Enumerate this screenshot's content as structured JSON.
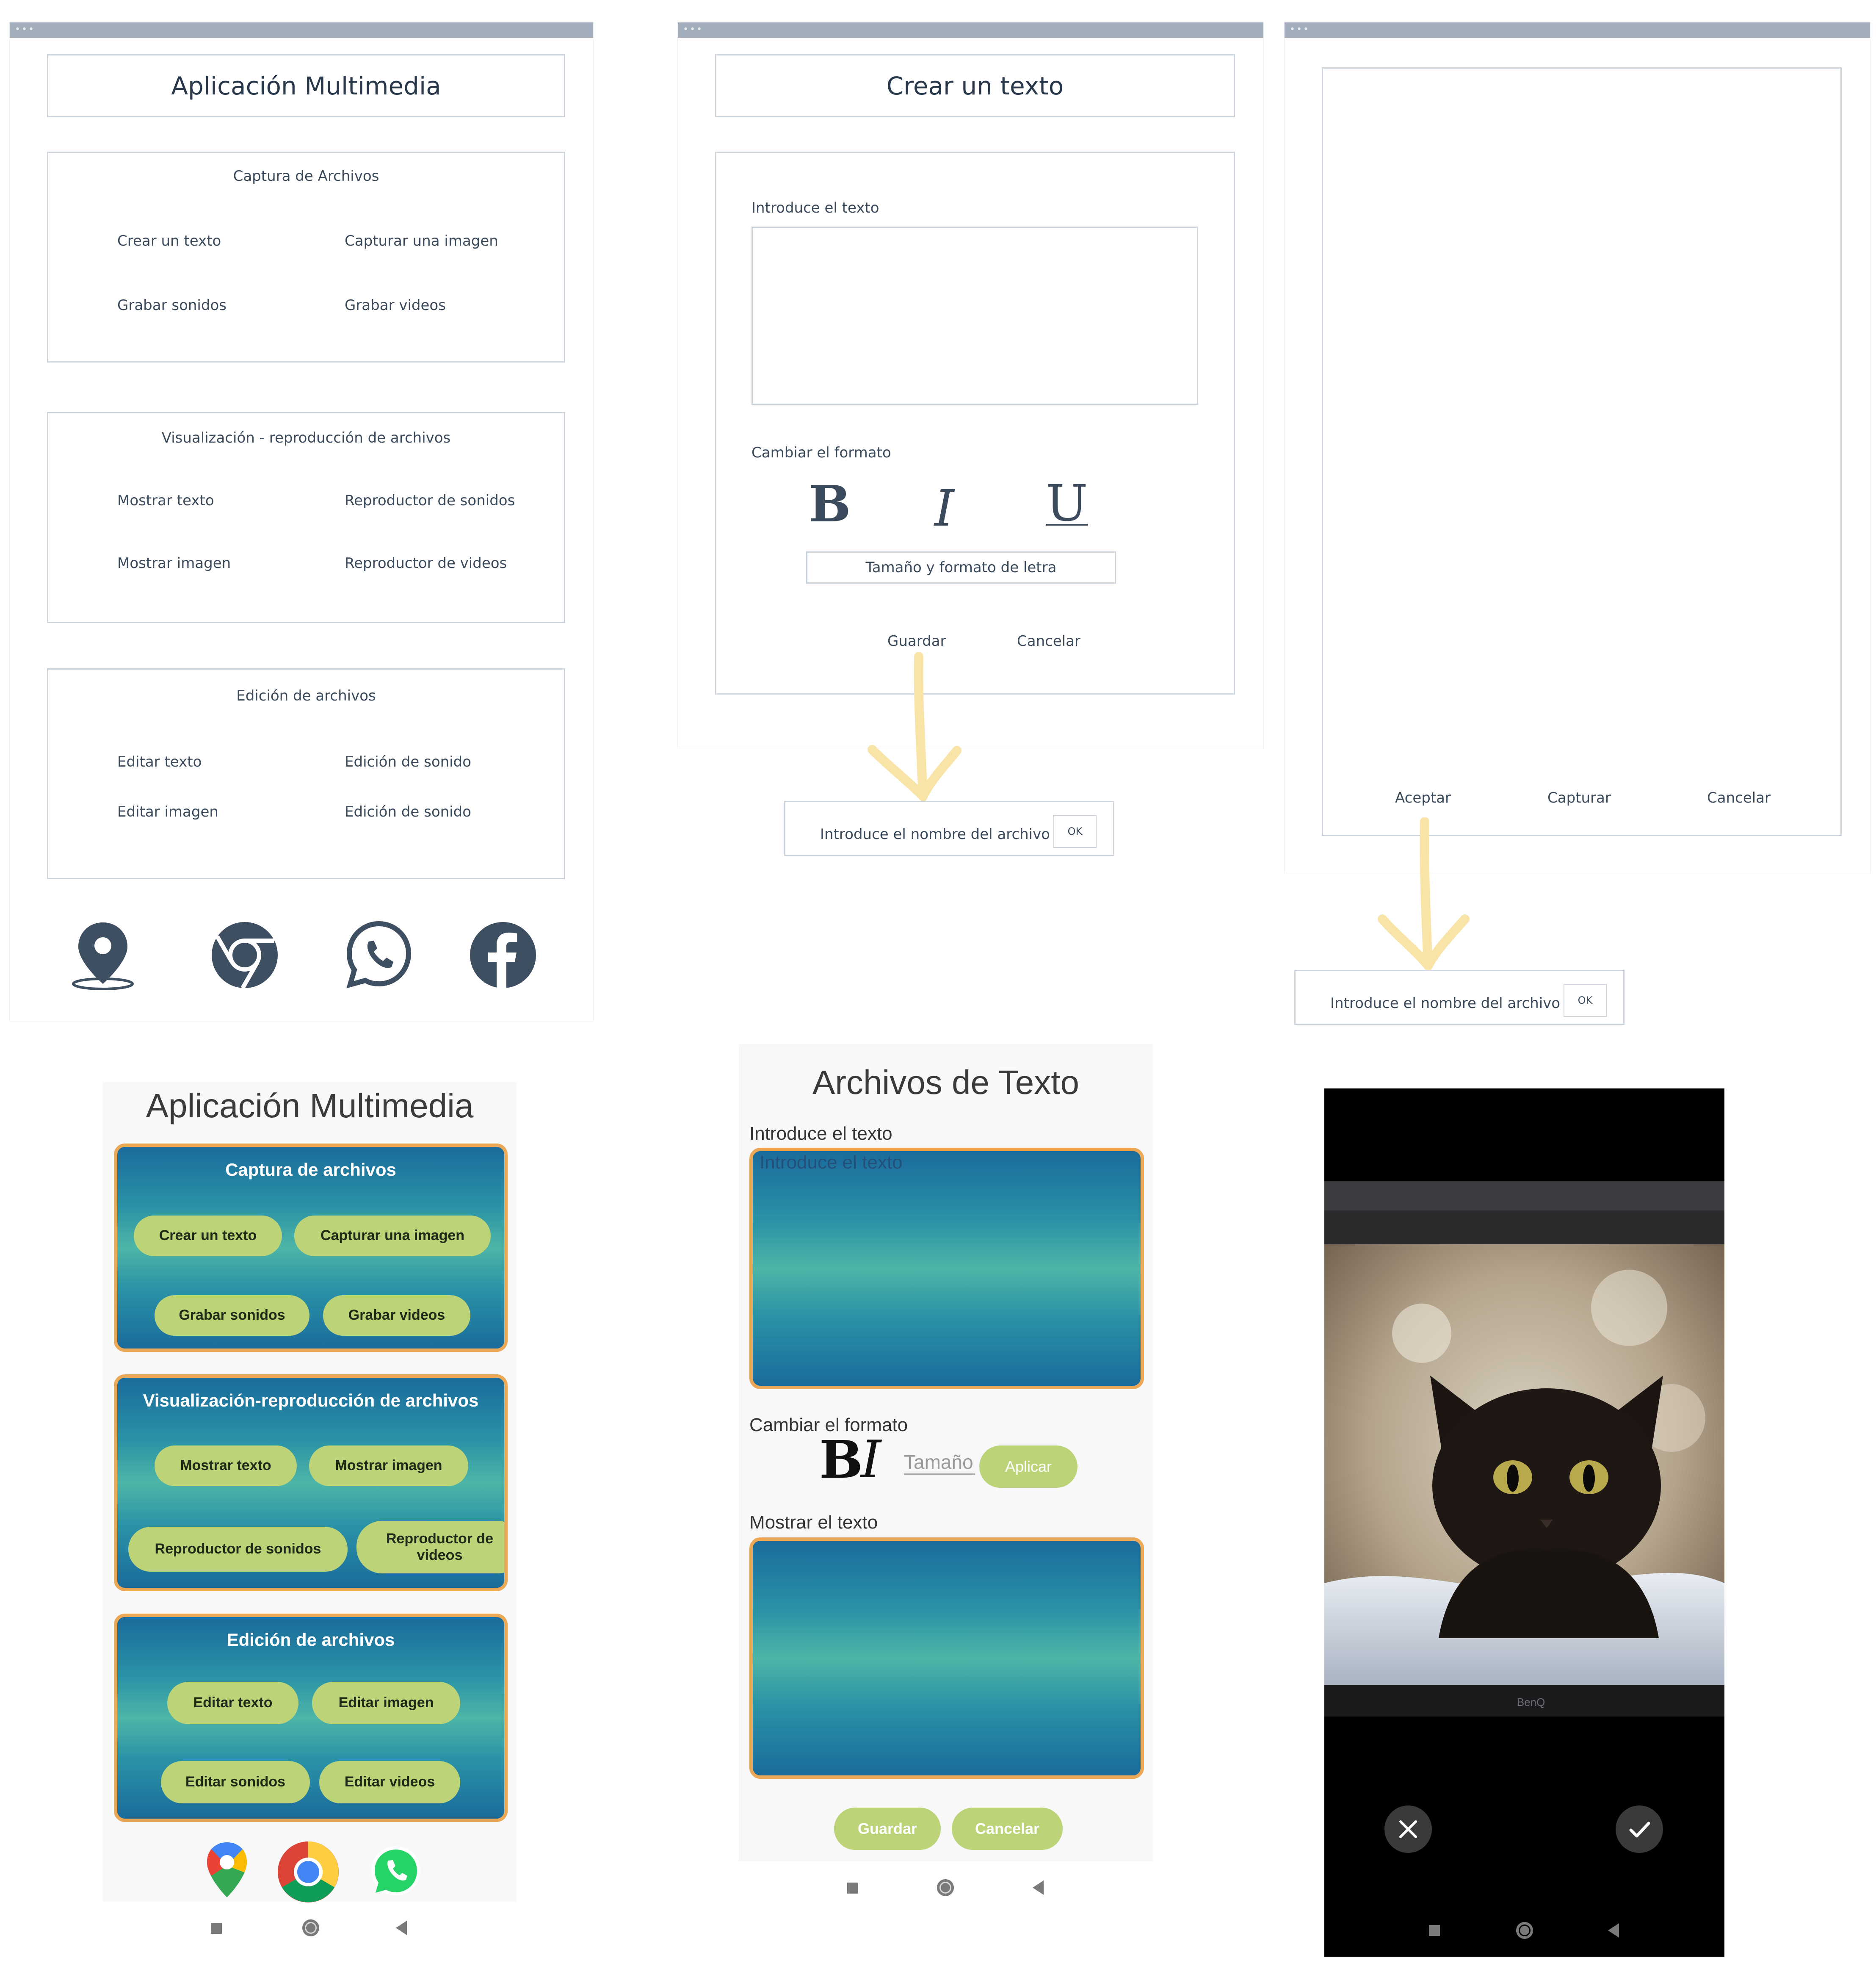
{
  "wf_main": {
    "title": "Aplicación Multimedia",
    "captura": {
      "heading": "Captura de Archivos",
      "items": [
        "Crear un texto",
        "Capturar una imagen",
        "Grabar sonidos",
        "Grabar videos"
      ]
    },
    "visualizacion": {
      "heading": "Visualización - reproducción de archivos",
      "items": [
        "Mostrar texto",
        "Reproductor de sonidos",
        "Mostrar imagen",
        "Reproductor de videos"
      ]
    },
    "edicion": {
      "heading": "Edición de archivos",
      "items": [
        "Editar texto",
        "Edición de sonido",
        "Editar imagen",
        "Edición de sonido"
      ]
    },
    "icons": [
      "map-pin-icon",
      "chrome-icon",
      "whatsapp-icon",
      "facebook-icon"
    ]
  },
  "wf_text": {
    "title": "Crear un texto",
    "input_label": "Introduce el texto",
    "format_label": "Cambiar el formato",
    "bold": "B",
    "italic": "I",
    "underline": "U",
    "font_size_button": "Tamaño  y formato de letra",
    "save": "Guardar",
    "cancel": "Cancelar",
    "filename_prompt": "Introduce el nombre del archivo",
    "ok": "OK"
  },
  "wf_camera": {
    "accept": "Aceptar",
    "capture": "Capturar",
    "cancel": "Cancelar",
    "filename_prompt": "Introduce el nombre del archivo",
    "ok": "OK"
  },
  "phone_main": {
    "title": "Aplicación Multimedia",
    "captura": {
      "heading": "Captura de archivos",
      "buttons": [
        "Crear un texto",
        "Capturar una imagen",
        "Grabar sonidos",
        "Grabar videos"
      ]
    },
    "visualizacion": {
      "heading": "Visualización-reproducción de archivos",
      "buttons": [
        "Mostrar texto",
        "Mostrar imagen",
        "Reproductor de sonidos",
        "Reproductor de videos"
      ]
    },
    "edicion": {
      "heading": "Edición de archivos",
      "buttons": [
        "Editar texto",
        "Editar imagen",
        "Editar sonidos",
        "Editar videos"
      ]
    },
    "dock_icons": [
      "google-maps-icon",
      "chrome-icon",
      "whatsapp-icon"
    ]
  },
  "phone_text": {
    "title": "Archivos de Texto",
    "input_label": "Introduce el texto",
    "input_placeholder": "Introduce el texto",
    "format_label": "Cambiar el formato",
    "bold": "B",
    "italic": "I",
    "size_placeholder": "Tamaño",
    "apply": "Aplicar",
    "show_label": "Mostrar el texto",
    "save": "Guardar",
    "cancel": "Cancelar"
  },
  "phone_camera": {
    "brand": "BenQ",
    "icons": [
      "close-icon",
      "check-icon"
    ]
  },
  "colors": {
    "card_border": "#eba856",
    "button_green": "#bcd477",
    "gradient_dark": "#1b6b9c",
    "gradient_light": "#4eb5a7",
    "wireframe_icon": "#3e4f61"
  }
}
